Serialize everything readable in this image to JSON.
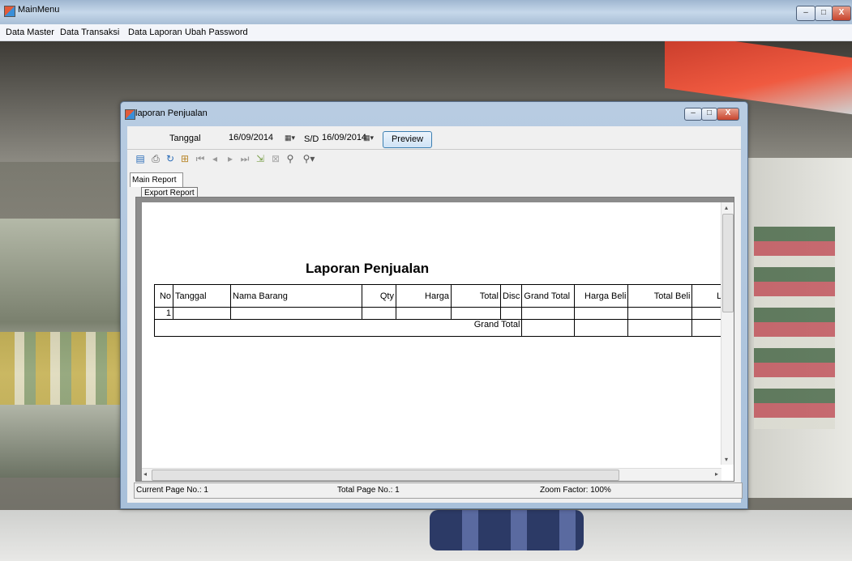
{
  "main_window": {
    "title": "MainMenu",
    "minimize": "–",
    "maximize": "□",
    "close": "X"
  },
  "menubar": {
    "items": [
      "Data Master",
      "Data Transaksi",
      "Data Laporan",
      "Ubah Password"
    ]
  },
  "report_window": {
    "title": "laporan Penjualan",
    "minimize": "–",
    "maximize": "□",
    "close": "X",
    "filter": {
      "tanggal_label": "Tanggal",
      "date_from": "16/09/2014",
      "separator": "S/D",
      "date_to": "16/09/2014",
      "preview_button": "Preview"
    },
    "toolbar": [
      "export-icon",
      "print-icon",
      "refresh-icon",
      "group-tree-icon",
      "first-page-icon",
      "prev-page-icon",
      "next-page-icon",
      "last-page-icon",
      "goto-page-icon",
      "stop-icon",
      "search-icon",
      "zoom-icon"
    ],
    "tab": "Main Report",
    "tooltip": "Export Report",
    "status": {
      "current_page": "Current Page No.: 1",
      "total_page": "Total Page No.: 1",
      "zoom": "Zoom Factor: 100%"
    }
  },
  "report": {
    "title": "Laporan Penjualan",
    "columns": [
      "No",
      "Tanggal",
      "Nama Barang",
      "Qty",
      "Harga",
      "Total",
      "Disc",
      "Grand Total",
      "Harga Beli",
      "Total Beli",
      "La"
    ],
    "rows": [
      [
        "1",
        "",
        "",
        "",
        "",
        "",
        "",
        "",
        "",
        "",
        ""
      ]
    ],
    "grand_total_label": "Grand Total"
  }
}
